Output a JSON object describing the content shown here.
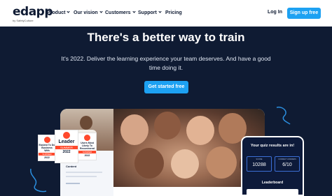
{
  "nav": {
    "logo": "edapp",
    "logo_sub": "by SafetyCulture",
    "items": [
      {
        "label": "Product"
      },
      {
        "label": "Our vision"
      },
      {
        "label": "Customers"
      },
      {
        "label": "Support"
      },
      {
        "label": "Pricing"
      }
    ],
    "login": "Log In",
    "signup": "Sign up free"
  },
  "hero": {
    "title": "There's a better way to train",
    "subtitle": "It's 2022. Deliver the learning experience your team deserves. And have a good time doing it.",
    "cta": "Get started free"
  },
  "badges": {
    "easiest": {
      "title": "Easiest To Do Business With",
      "ribbon": "SUMMER",
      "year": "2022"
    },
    "leader": {
      "title": "Leader",
      "ribbon": "SUMMER",
      "year": "2022"
    },
    "users_recommend": {
      "title": "Users Most Likely To Recommend",
      "ribbon": "SUMMER",
      "year": "2022"
    }
  },
  "left_panel": {
    "label": "Content"
  },
  "phone": {
    "title": "Your quiz results are in!",
    "score_label": "SCORE",
    "score_value": "10288",
    "correct_label": "CORRECT ANSWERS",
    "correct_value": "6/10",
    "leaderboard": "Leaderboard"
  },
  "colors": {
    "accent": "#1da1f2",
    "dark_bg": "#0f1b33",
    "g2_red": "#ff492c"
  }
}
